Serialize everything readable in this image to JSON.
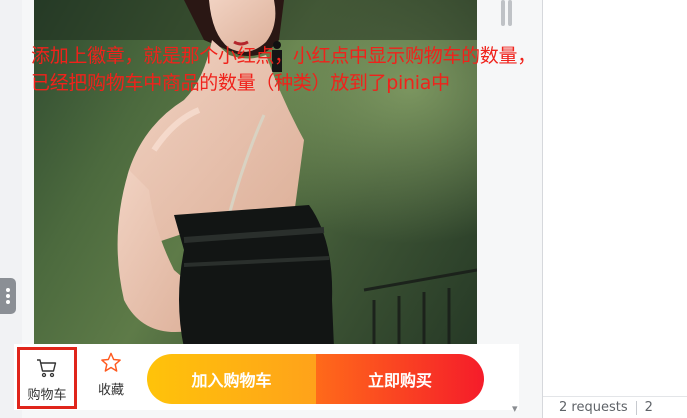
{
  "annotation": {
    "line1": "添加上徽章，就是那个小红点，小红点中显示购物车的数量，",
    "line2": "已经把购物车中商品的数量（种类）放到了pinia中"
  },
  "action_bar": {
    "cart_label": "购物车",
    "favorite_label": "收藏",
    "add_to_cart_label": "加入购物车",
    "buy_now_label": "立即购买"
  },
  "devtools": {
    "footer_requests": "2 requests",
    "footer_extra": "2"
  },
  "icons": {
    "cart": "cart-icon",
    "favorite": "star-icon",
    "side_handle": "more-vertical-icon"
  },
  "colors": {
    "annotation_text": "#f0221b",
    "highlight_border": "#e0251b",
    "add_to_cart_gradient": [
      "#ffc30a",
      "#ffa21a"
    ],
    "buy_now_gradient": [
      "#ff6a1a",
      "#f51c2a"
    ],
    "favorite_icon": "#ff5a1f"
  }
}
